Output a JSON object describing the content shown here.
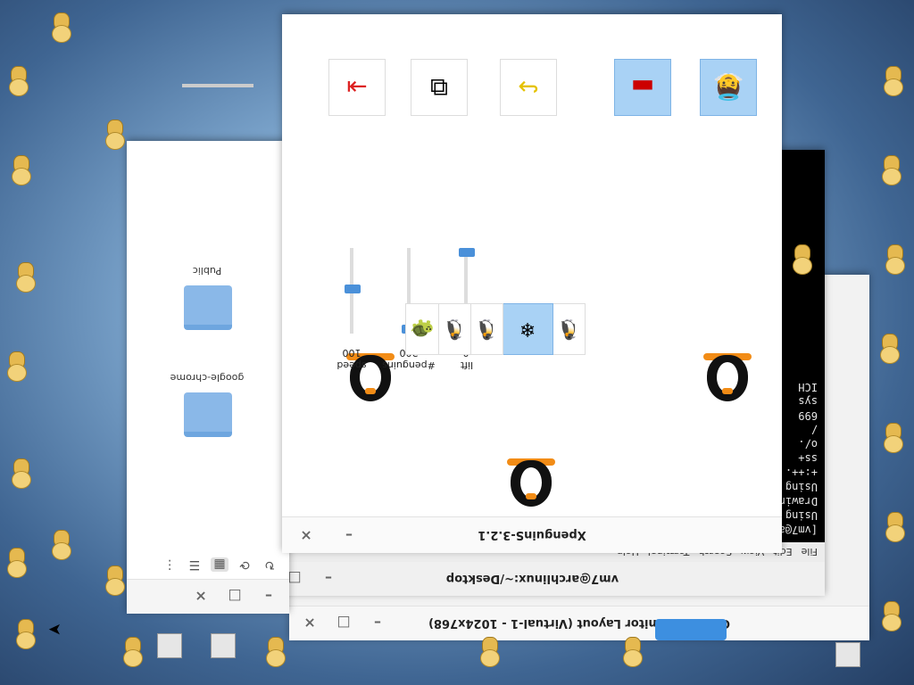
{
  "windows": {
    "monitor": {
      "title": "Current Monitor Layout (Virtual-1 - 1024x768)",
      "menu_icon": "⋯"
    },
    "terminal": {
      "title": "vm7@archlinux:~/Desktop",
      "menu": [
        "File",
        "Edit",
        "View",
        "Search",
        "Terminal",
        "Help"
      ],
      "lines": [
        "[vm7@a",
        "Using",
        "Drawin",
        "Using",
        "",
        "",
        "+:++.",
        "ss+",
        "o/.",
        "/",
        "",
        "699",
        "",
        "",
        "",
        "",
        "",
        "",
        "",
        "sys",
        "",
        "ICH"
      ]
    },
    "files": {
      "folders": [
        {
          "name": "google-chrome"
        },
        {
          "name": "Public"
        }
      ],
      "view_icons": [
        "rotate-icon",
        "grid-icon",
        "list-icon",
        "compact-icon"
      ]
    },
    "xpenguins": {
      "title": "XpenguinS-3.2.1",
      "controls": {
        "minimize": "–",
        "close": "×"
      },
      "sliders": [
        {
          "label": "lift",
          "value": "0"
        },
        {
          "label": "#penguins",
          "value": "200"
        },
        {
          "label": "speed",
          "value": "100"
        }
      ],
      "toolbar": [
        "angel-penguin",
        "blood-splat",
        "redo-arrow",
        "move-windows",
        "exit-door"
      ]
    }
  },
  "colors": {
    "accent": "#a9d2f5",
    "slider": "#4a90d9"
  }
}
